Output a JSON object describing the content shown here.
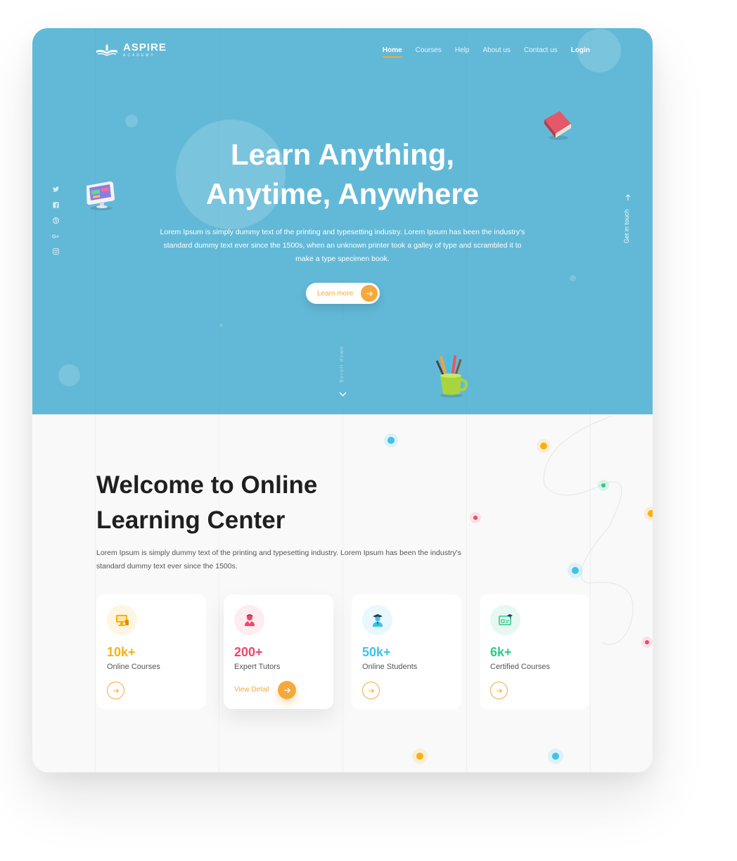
{
  "brand": {
    "name": "ASPIRE",
    "tagline": "ACADEMY"
  },
  "nav": {
    "items": [
      "Home",
      "Courses",
      "Help",
      "About us",
      "Contact us"
    ],
    "active": "Home",
    "login": "Login"
  },
  "hero": {
    "title_line1": "Learn Anything,",
    "title_line2": "Anytime, Anywhere",
    "description": "Lorem Ipsum is simply dummy text of the printing and typesetting industry. Lorem Ipsum has been the industry's standard dummy text ever since the 1500s, when an unknown printer took a galley of type and scrambled it to make a type specimen book.",
    "cta_label": "Learn more",
    "side_link": "Get in touch",
    "scroll_label": "Scroll down"
  },
  "social": [
    "twitter-icon",
    "facebook-icon",
    "dribbble-icon",
    "google-plus-icon",
    "instagram-icon"
  ],
  "welcome": {
    "title_line1": "Welcome to Online",
    "title_line2": "Learning Center",
    "description": "Lorem Ipsum is simply dummy text of the printing and typesetting industry. Lorem Ipsum has been the industry's standard dummy text ever since the 1500s."
  },
  "stats": [
    {
      "value": "10k+",
      "label": "Online Courses",
      "color": "#f9b10f",
      "icon": "monitor-icon"
    },
    {
      "value": "200+",
      "label": "Expert Tutors",
      "color": "#f0466a",
      "icon": "tutor-icon",
      "action_label": "View Detail"
    },
    {
      "value": "50k+",
      "label": "Online Students",
      "color": "#3ec2e9",
      "icon": "student-icon"
    },
    {
      "value": "6k+",
      "label": "Certified Courses",
      "color": "#2fc98a",
      "icon": "certificate-icon"
    }
  ],
  "colors": {
    "hero_bg": "#62b9d7",
    "accent": "#f6a93b",
    "page_bg": "#f9f9f9"
  }
}
